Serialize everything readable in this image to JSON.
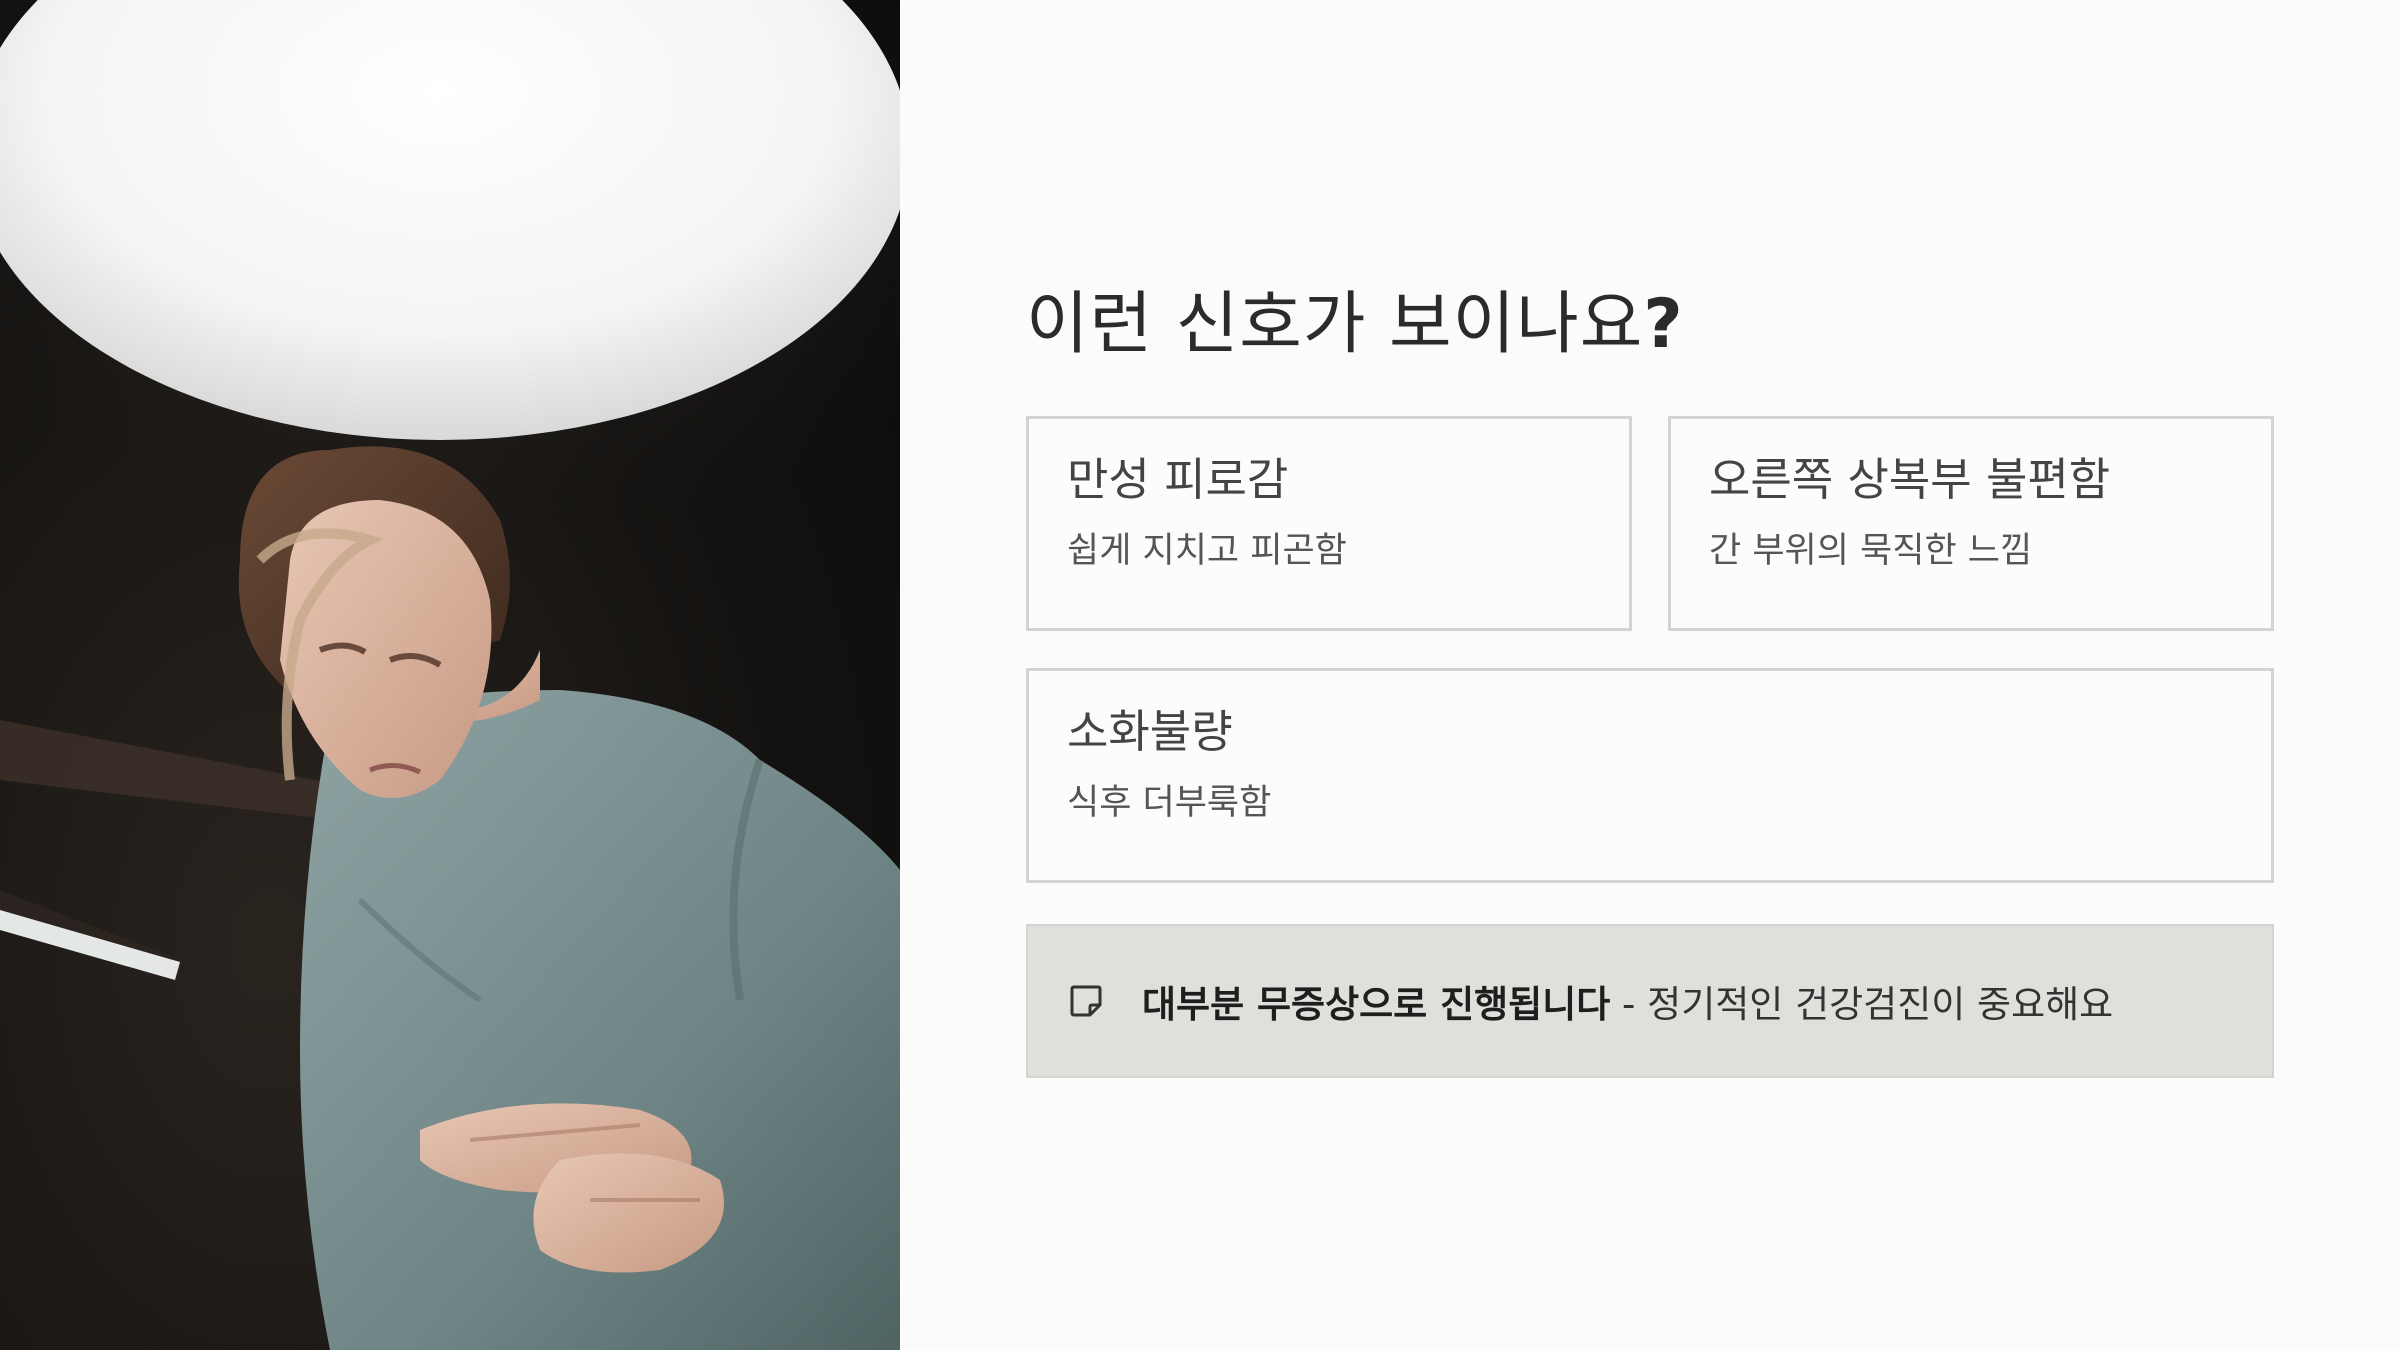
{
  "photo": {
    "description_icon": "person-holding-stomach-image"
  },
  "title": {
    "text": "이런 신호가 보이나요",
    "mark": "?"
  },
  "cards": [
    {
      "title": "만성 피로감",
      "desc": "쉽게 지치고 피곤함"
    },
    {
      "title": "오른쪽 상복부 불편함",
      "desc": "간 부위의 묵직한 느낌"
    },
    {
      "title": "소화불량",
      "desc": "식후 더부룩함"
    }
  ],
  "notice": {
    "icon": "note-icon",
    "strong": "대부분 무증상으로 진행됩니다",
    "rest": " - 정기적인 건강검진이 중요해요"
  },
  "colors": {
    "background": "#fbfbfb",
    "card_border": "#d6d2d4",
    "notice_bg": "#dfdfdb",
    "text_dark": "#2b2b2b"
  }
}
